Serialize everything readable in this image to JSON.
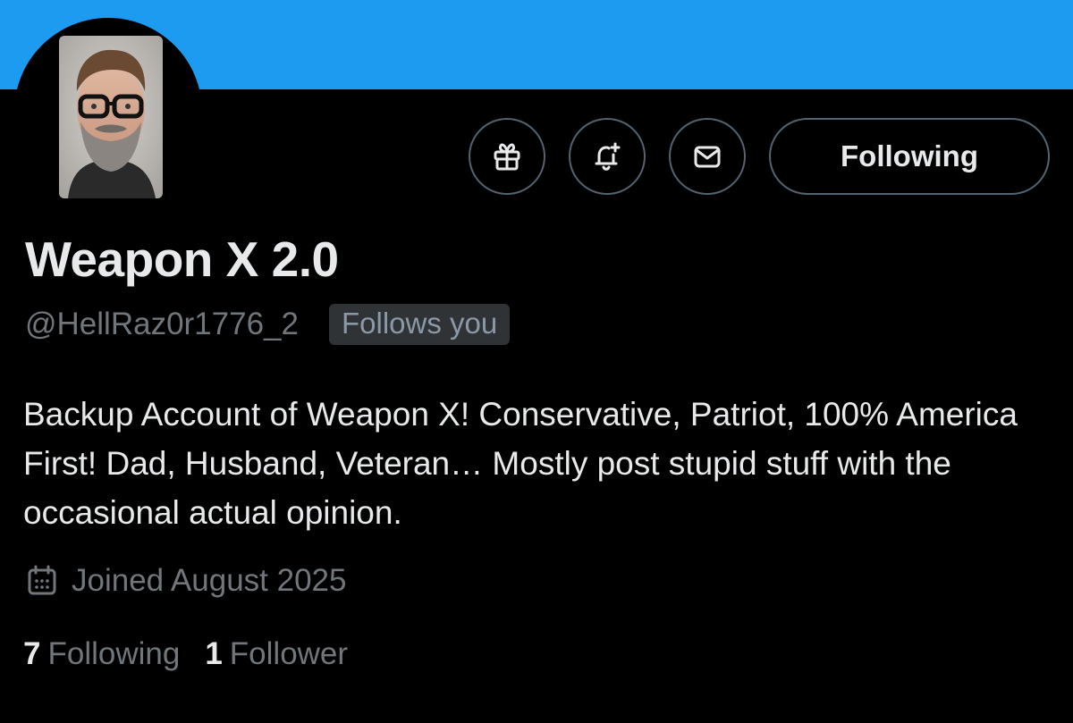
{
  "profile": {
    "display_name": "Weapon X 2.0",
    "handle": "@HellRaz0r1776_2",
    "follows_you_badge": "Follows you",
    "bio": "Backup Account of Weapon X! Conservative, Patriot, 100% America First! Dad, Husband, Veteran… Mostly post stupid stuff with the occasional actual opinion.",
    "joined": "Joined August 2025",
    "avatar_icon": "profile-photo"
  },
  "actions": {
    "gift_icon": "gift-icon",
    "notify_icon": "bell-plus-icon",
    "message_icon": "envelope-icon",
    "follow_label": "Following"
  },
  "stats": {
    "following_count": "7",
    "following_label": "Following",
    "followers_count": "1",
    "followers_label": "Follower"
  },
  "colors": {
    "banner": "#1d9bf0",
    "background": "#000000",
    "text_primary": "#e7e9ea",
    "text_secondary": "#71767b",
    "badge_bg": "#2f3336"
  }
}
